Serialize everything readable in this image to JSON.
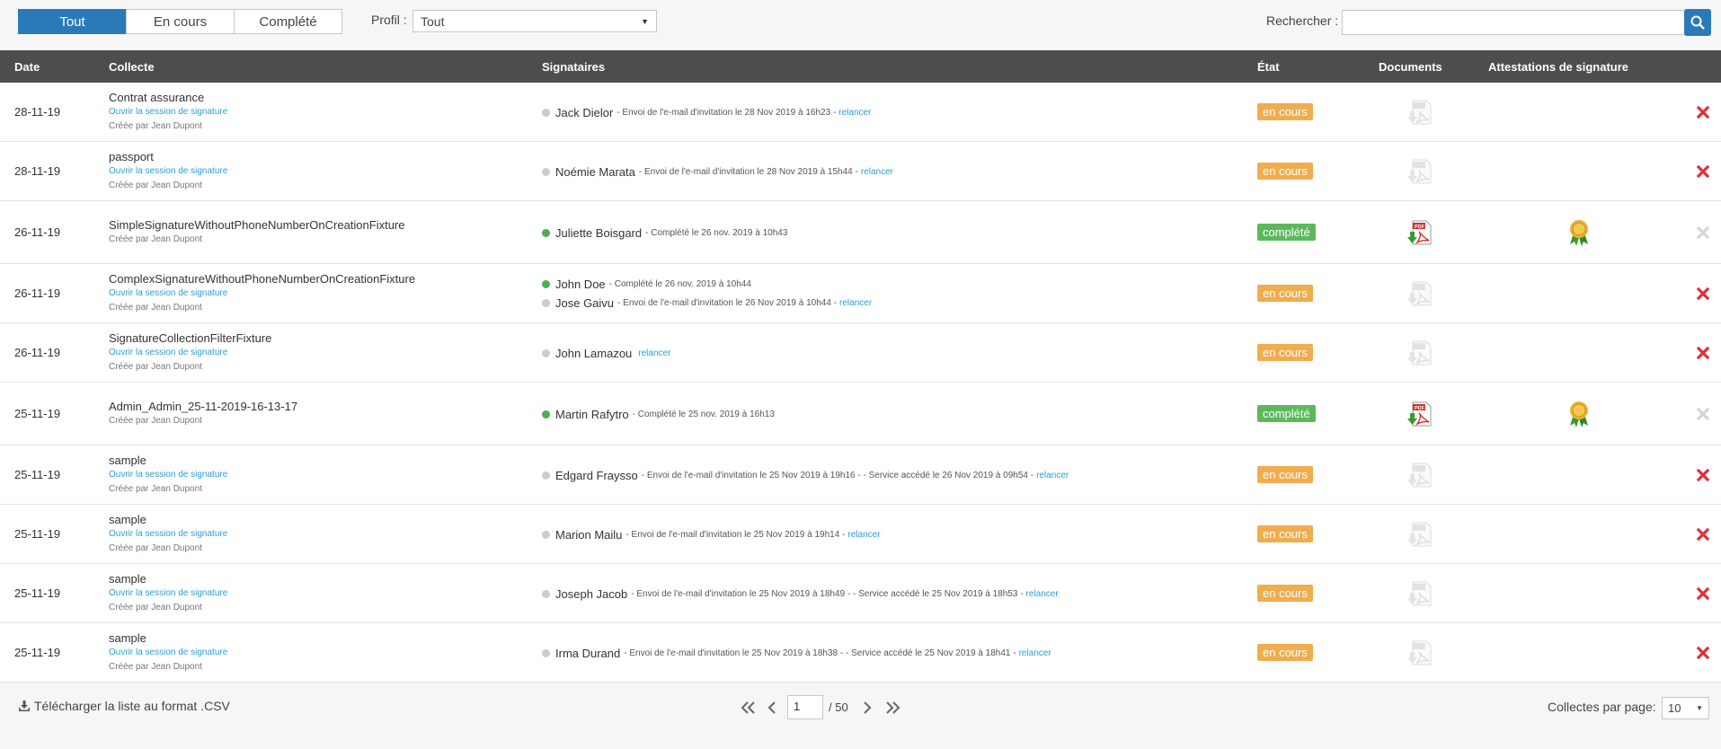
{
  "filters": {
    "tabs": [
      "Tout",
      "En cours",
      "Complété"
    ],
    "active_tab": "Tout",
    "profil_label": "Profil :",
    "profil_value": "Tout",
    "search_label": "Rechercher :",
    "search_value": ""
  },
  "table": {
    "headers": {
      "date": "Date",
      "collecte": "Collecte",
      "signataires": "Signataires",
      "etat": "État",
      "documents": "Documents",
      "attestations": "Attestations de signature"
    },
    "rows": [
      {
        "date": "28-11-19",
        "name": "Contrat assurance",
        "link": "Ouvrir la session de signature",
        "creator": "Créée par Jean Dupont",
        "signers": [
          {
            "name": "Jack Dielor",
            "status": "pending",
            "detail": "- Envoi de l'e-mail d'invitation le 28 Nov 2019 à 16h23 -",
            "relancer": "relancer"
          }
        ],
        "state": "en cours",
        "state_type": "encours",
        "doc_active": false,
        "cert": false,
        "delete_active": true
      },
      {
        "date": "28-11-19",
        "name": "passport",
        "link": "Ouvrir la session de signature",
        "creator": "Créée par Jean Dupont",
        "signers": [
          {
            "name": "Noémie Marata",
            "status": "pending",
            "detail": "- Envoi de l'e-mail d'invitation le 28 Nov 2019 à 15h44 -",
            "relancer": "relancer"
          }
        ],
        "state": "en cours",
        "state_type": "encours",
        "doc_active": false,
        "cert": false,
        "delete_active": true
      },
      {
        "date": "26-11-19",
        "name": "SimpleSignatureWithoutPhoneNumberOnCreationFixture",
        "link": "",
        "creator": "Créée par Jean Dupont",
        "signers": [
          {
            "name": "Juliette Boisgard",
            "status": "done",
            "detail": "- Complété le 26 nov. 2019 à 10h43",
            "relancer": ""
          }
        ],
        "state": "complété",
        "state_type": "complete",
        "doc_active": true,
        "cert": true,
        "delete_active": false
      },
      {
        "date": "26-11-19",
        "name": "ComplexSignatureWithoutPhoneNumberOnCreationFixture",
        "link": "Ouvrir la session de signature",
        "creator": "Créée par Jean Dupont",
        "signers": [
          {
            "name": "John Doe",
            "status": "done",
            "detail": "- Complété le 26 nov. 2019 à 10h44",
            "relancer": ""
          },
          {
            "name": "Jose Gaivu",
            "status": "pending",
            "detail": "- Envoi de l'e-mail d'invitation le 26 Nov 2019 à 10h44 -",
            "relancer": "relancer"
          }
        ],
        "state": "en cours",
        "state_type": "encours",
        "doc_active": false,
        "cert": false,
        "delete_active": true
      },
      {
        "date": "26-11-19",
        "name": "SignatureCollectionFilterFixture",
        "link": "Ouvrir la session de signature",
        "creator": "Créée par Jean Dupont",
        "signers": [
          {
            "name": "John Lamazou",
            "status": "pending",
            "detail": "",
            "relancer": "relancer"
          }
        ],
        "state": "en cours",
        "state_type": "encours",
        "doc_active": false,
        "cert": false,
        "delete_active": true
      },
      {
        "date": "25-11-19",
        "name": "Admin_Admin_25-11-2019-16-13-17",
        "link": "",
        "creator": "Créée par Jean Dupont",
        "signers": [
          {
            "name": "Martin Rafytro",
            "status": "done",
            "detail": "- Complété le 25 nov. 2019 à 16h13",
            "relancer": ""
          }
        ],
        "state": "complété",
        "state_type": "complete",
        "doc_active": true,
        "cert": true,
        "delete_active": false
      },
      {
        "date": "25-11-19",
        "name": "sample",
        "link": "Ouvrir la session de signature",
        "creator": "Créée par Jean Dupont",
        "signers": [
          {
            "name": "Edgard Fraysso",
            "status": "pending",
            "detail": "- Envoi de l'e-mail d'invitation le 25 Nov 2019 à 19h16 - - Service accédé le 26 Nov 2019 à 09h54 -",
            "relancer": "relancer"
          }
        ],
        "state": "en cours",
        "state_type": "encours",
        "doc_active": false,
        "cert": false,
        "delete_active": true
      },
      {
        "date": "25-11-19",
        "name": "sample",
        "link": "Ouvrir la session de signature",
        "creator": "Créée par Jean Dupont",
        "signers": [
          {
            "name": "Marion Mailu",
            "status": "pending",
            "detail": "- Envoi de l'e-mail d'invitation le 25 Nov 2019 à 19h14 -",
            "relancer": "relancer"
          }
        ],
        "state": "en cours",
        "state_type": "encours",
        "doc_active": false,
        "cert": false,
        "delete_active": true
      },
      {
        "date": "25-11-19",
        "name": "sample",
        "link": "Ouvrir la session de signature",
        "creator": "Créée par Jean Dupont",
        "signers": [
          {
            "name": "Joseph Jacob",
            "status": "pending",
            "detail": "- Envoi de l'e-mail d'invitation le 25 Nov 2019 à 18h49 - - Service accédé le 25 Nov 2019 à 18h53 -",
            "relancer": "relancer"
          }
        ],
        "state": "en cours",
        "state_type": "encours",
        "doc_active": false,
        "cert": false,
        "delete_active": true
      },
      {
        "date": "25-11-19",
        "name": "sample",
        "link": "Ouvrir la session de signature",
        "creator": "Créée par Jean Dupont",
        "signers": [
          {
            "name": "Irma Durand",
            "status": "pending",
            "detail": "- Envoi de l'e-mail d'invitation le 25 Nov 2019 à 18h38 - - Service accédé le 25 Nov 2019 à 18h41 -",
            "relancer": "relancer"
          }
        ],
        "state": "en cours",
        "state_type": "encours",
        "doc_active": false,
        "cert": false,
        "delete_active": true
      }
    ]
  },
  "footer": {
    "csv_label": "Télécharger la liste au format .CSV",
    "page_current": "1",
    "page_total": "/ 50",
    "per_page_label": "Collectes par page:",
    "per_page_value": "10"
  },
  "colors": {
    "accent": "#2a7ab9",
    "link": "#2a9fd6",
    "header_bg": "#4d4d4d",
    "badge_encours": "#f0ad4e",
    "badge_complete": "#5cb85c",
    "delete": "#e0303a"
  },
  "icons": {
    "search": "search-icon",
    "pdf": "pdf-download-icon",
    "certificate": "certificate-ribbon-icon",
    "delete": "delete-x-icon",
    "csv": "download-icon",
    "pager": [
      "first-page-icon",
      "prev-page-icon",
      "next-page-icon",
      "last-page-icon"
    ]
  }
}
